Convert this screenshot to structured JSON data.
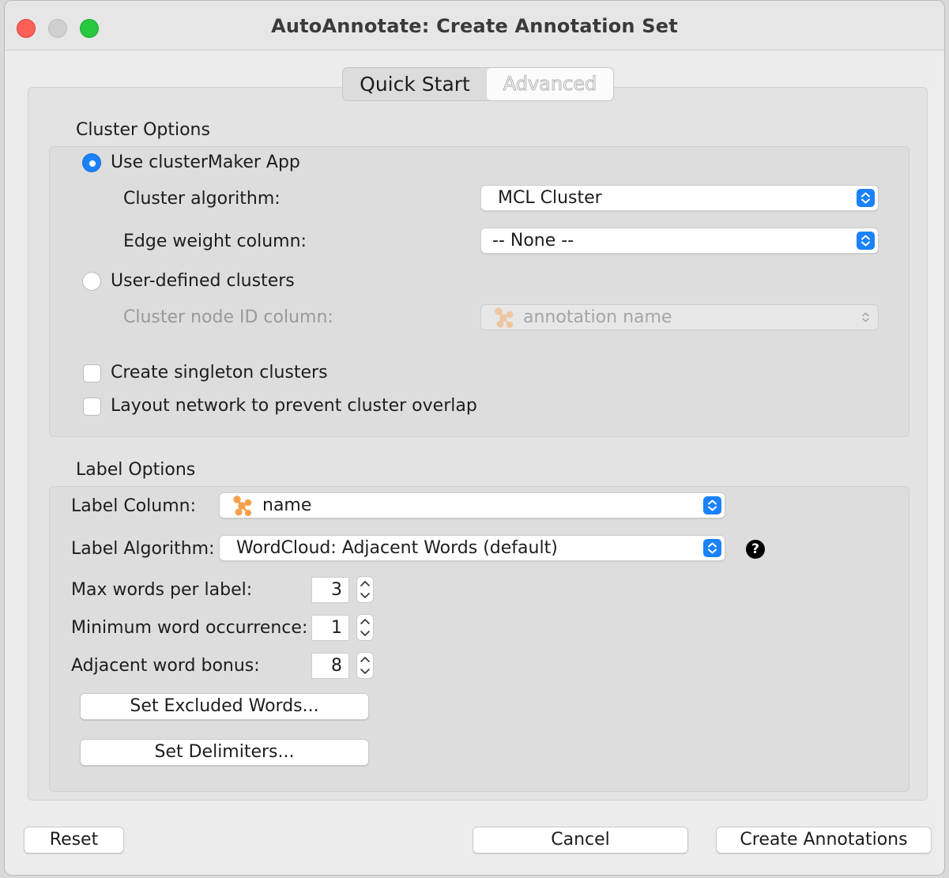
{
  "window": {
    "title": "AutoAnnotate: Create Annotation Set"
  },
  "tabs": [
    {
      "label": "Quick Start"
    },
    {
      "label": "Advanced"
    }
  ],
  "cluster_options": {
    "heading": "Cluster Options",
    "use_clustermaker": {
      "label": "Use clusterMaker App",
      "selected": true
    },
    "cluster_algorithm": {
      "label": "Cluster algorithm:",
      "value": "MCL Cluster"
    },
    "edge_weight_column": {
      "label": "Edge weight column:",
      "value": "-- None --"
    },
    "user_defined": {
      "label": "User-defined clusters",
      "selected": false
    },
    "cluster_node_id_column": {
      "label": "Cluster node ID column:",
      "value": "annotation name"
    },
    "create_singleton": {
      "label": "Create singleton clusters",
      "checked": false
    },
    "layout_network": {
      "label": "Layout network to prevent cluster overlap",
      "checked": false
    }
  },
  "label_options": {
    "heading": "Label Options",
    "label_column": {
      "label": "Label Column:",
      "value": "name"
    },
    "label_algorithm": {
      "label": "Label Algorithm:",
      "value": "WordCloud: Adjacent Words (default)"
    },
    "max_words": {
      "label": "Max words per label:",
      "value": "3"
    },
    "min_occurrence": {
      "label": "Minimum word occurrence:",
      "value": "1"
    },
    "adjacent_bonus": {
      "label": "Adjacent word bonus:",
      "value": "8"
    },
    "set_excluded_words": "Set Excluded Words...",
    "set_delimiters": "Set Delimiters..."
  },
  "footer": {
    "reset": "Reset",
    "cancel": "Cancel",
    "create": "Create Annotations"
  },
  "colors": {
    "accent": "#1a82fb",
    "close": "#fe5f57",
    "maximize": "#28c840",
    "cytoscape_icon": "#f6a04d"
  },
  "icons": {
    "stepper": "chevron-up-down-icon",
    "column_type": "cytoscape-node-icon",
    "help": "question-mark-icon"
  }
}
